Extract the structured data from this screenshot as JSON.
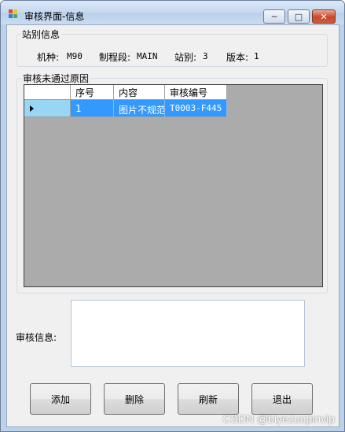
{
  "window": {
    "title": "审核界面-信息",
    "controls": {
      "minimize": "─",
      "maximize": "□",
      "close": "✕"
    }
  },
  "station_group": {
    "legend": "站别信息",
    "model_label": "机种:",
    "model_value": "M90",
    "process_label": "制程段:",
    "process_value": "MAIN",
    "station_label": "站别:",
    "station_value": "3",
    "version_label": "版本:",
    "version_value": "1"
  },
  "reason_group": {
    "legend": "审核未通过原因",
    "columns": [
      "序号",
      "内容",
      "审核编号"
    ],
    "rows": [
      {
        "seq": "1",
        "content": "图片不规范",
        "code": "T0003-F445"
      }
    ]
  },
  "audit_info": {
    "label": "审核信息:",
    "value": ""
  },
  "buttons": {
    "add": "添加",
    "delete": "删除",
    "refresh": "刷新",
    "exit": "退出"
  },
  "watermark": "CSDN @biyezuopinvip",
  "colors": {
    "selection": "#3399ff",
    "row_header_selected": "#99d6f5",
    "grid_background": "#ababab"
  }
}
